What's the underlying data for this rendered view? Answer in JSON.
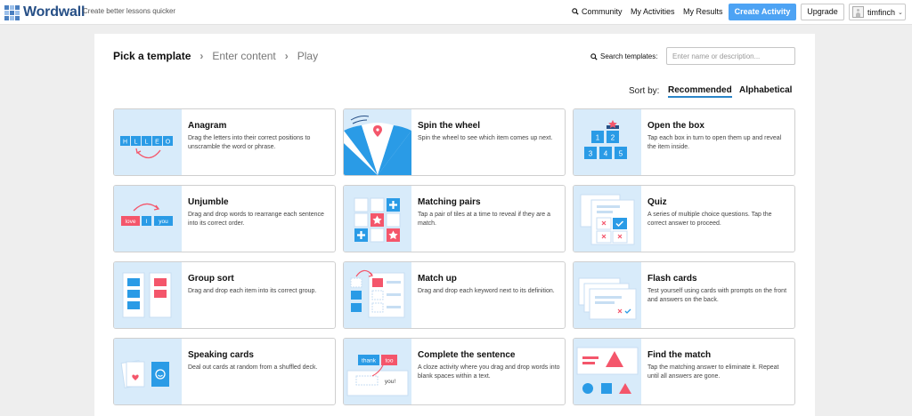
{
  "header": {
    "logo_text": "Wordwall",
    "tagline": "Create better lessons quicker",
    "nav": {
      "community": "Community",
      "my_activities": "My Activities",
      "my_results": "My Results"
    },
    "create_activity": "Create Activity",
    "upgrade": "Upgrade",
    "username": "timfinch"
  },
  "breadcrumb": {
    "step1": "Pick a template",
    "step2": "Enter content",
    "step3": "Play"
  },
  "search": {
    "label": "Search templates:",
    "placeholder": "Enter name or description..."
  },
  "sort": {
    "label": "Sort by:",
    "recommended": "Recommended",
    "alphabetical": "Alphabetical",
    "selected": "Recommended"
  },
  "templates": [
    {
      "title": "Anagram",
      "desc": "Drag the letters into their correct positions to unscramble the word or phrase.",
      "icon": "anagram-icon",
      "letters": [
        "H",
        "L",
        "L",
        "E",
        "O"
      ]
    },
    {
      "title": "Spin the wheel",
      "desc": "Spin the wheel to see which item comes up next.",
      "icon": "spin-wheel-icon"
    },
    {
      "title": "Open the box",
      "desc": "Tap each box in turn to open them up and reveal the item inside.",
      "icon": "open-box-icon",
      "numbers": [
        "1",
        "2",
        "3",
        "4",
        "5"
      ]
    },
    {
      "title": "Unjumble",
      "desc": "Drag and drop words to rearrange each sentence into its correct order.",
      "icon": "unjumble-icon",
      "words": [
        "love",
        "I",
        "you"
      ]
    },
    {
      "title": "Matching pairs",
      "desc": "Tap a pair of tiles at a time to reveal if they are a match.",
      "icon": "matching-pairs-icon"
    },
    {
      "title": "Quiz",
      "desc": "A series of multiple choice questions. Tap the correct answer to proceed.",
      "icon": "quiz-icon"
    },
    {
      "title": "Group sort",
      "desc": "Drag and drop each item into its correct group.",
      "icon": "group-sort-icon"
    },
    {
      "title": "Match up",
      "desc": "Drag and drop each keyword next to its definition.",
      "icon": "match-up-icon"
    },
    {
      "title": "Flash cards",
      "desc": "Test yourself using cards with prompts on the front and answers on the back.",
      "icon": "flash-cards-icon"
    },
    {
      "title": "Speaking cards",
      "desc": "Deal out cards at random from a shuffled deck.",
      "icon": "speaking-cards-icon"
    },
    {
      "title": "Complete the sentence",
      "desc": "A cloze activity where you drag and drop words into blank spaces within a text.",
      "icon": "complete-sentence-icon",
      "words": [
        "thank",
        "too",
        "you!"
      ]
    },
    {
      "title": "Find the match",
      "desc": "Tap the matching answer to eliminate it. Repeat until all answers are gone.",
      "icon": "find-match-icon"
    }
  ],
  "colors": {
    "accent_blue": "#4da3f4",
    "brand_navy": "#264f86",
    "tile_blue": "#2a9be6",
    "tile_red": "#f4566b",
    "thumb_bg": "#d8ebfa"
  }
}
